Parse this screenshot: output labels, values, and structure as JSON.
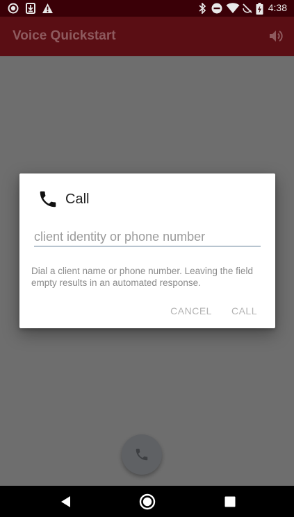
{
  "status_bar": {
    "time": "4:38",
    "left_icons": [
      "record-icon",
      "download-icon",
      "warning-icon"
    ],
    "right_icons": [
      "bluetooth-icon",
      "do-not-disturb-icon",
      "wifi-icon",
      "battery-icon"
    ]
  },
  "app_bar": {
    "title": "Voice Quickstart",
    "action_icon": "volume-icon"
  },
  "dialog": {
    "title": "Call",
    "icon": "phone-icon",
    "input": {
      "value": "",
      "placeholder": "client identity or phone number"
    },
    "help_text": "Dial a client name or phone number. Leaving the field empty results in an automated response.",
    "buttons": {
      "cancel": "CANCEL",
      "call": "CALL"
    }
  },
  "fab": {
    "icon": "phone-icon"
  },
  "nav_bar": {
    "buttons": [
      "back-icon",
      "home-icon",
      "recents-icon"
    ]
  },
  "colors": {
    "status_bar": "#3a0007",
    "app_bar": "#5a0e14",
    "scrim": "#6e6e6e",
    "dialog": "#ffffff",
    "input_underline": "#b7c4cf",
    "button_text": "#b3b3b3"
  }
}
